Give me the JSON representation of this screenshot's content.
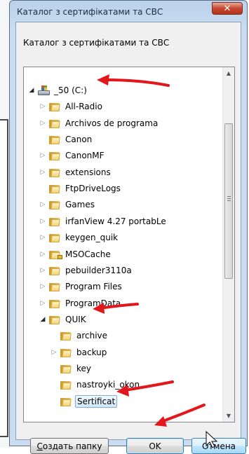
{
  "window": {
    "title": "Каталог з сертифікатами та СВС",
    "close_glyph": "✕"
  },
  "prompt": "Каталог з сертифікатами та СВС",
  "tree": {
    "items": [
      {
        "label": "_50 (C:)",
        "icon": "drive-icon",
        "expand": "open",
        "level": 0
      },
      {
        "label": "All-Radio",
        "icon": "folder-icon",
        "expand": "closed",
        "level": 1
      },
      {
        "label": "Archivos de programa",
        "icon": "folder-icon",
        "expand": "closed",
        "level": 1
      },
      {
        "label": "Canon",
        "icon": "folder-icon",
        "expand": "none",
        "level": 1
      },
      {
        "label": "CanonMF",
        "icon": "folder-icon",
        "expand": "closed",
        "level": 1
      },
      {
        "label": "extensions",
        "icon": "folder-icon",
        "expand": "closed",
        "level": 1
      },
      {
        "label": "FtpDriveLogs",
        "icon": "folder-icon",
        "expand": "none",
        "level": 1
      },
      {
        "label": "Games",
        "icon": "folder-icon",
        "expand": "closed",
        "level": 1
      },
      {
        "label": "irfanView 4.27 portabLe",
        "icon": "folder-icon",
        "expand": "closed",
        "level": 1
      },
      {
        "label": "keygen_quik",
        "icon": "folder-icon",
        "expand": "closed",
        "level": 1
      },
      {
        "label": "MSOCache",
        "icon": "locked-folder-icon",
        "expand": "closed",
        "level": 1
      },
      {
        "label": "pebuilder3110a",
        "icon": "folder-icon",
        "expand": "closed",
        "level": 1
      },
      {
        "label": "Program Files",
        "icon": "folder-icon",
        "expand": "closed",
        "level": 1
      },
      {
        "label": "ProgramData",
        "icon": "folder-icon",
        "expand": "closed",
        "level": 1
      },
      {
        "label": "QUIK",
        "icon": "folder-icon",
        "expand": "open",
        "level": 1
      },
      {
        "label": "archive",
        "icon": "folder-icon",
        "expand": "none",
        "level": 2
      },
      {
        "label": "backup",
        "icon": "folder-icon",
        "expand": "closed",
        "level": 2
      },
      {
        "label": "key",
        "icon": "folder-icon",
        "expand": "none",
        "level": 2
      },
      {
        "label": "nastroyki_okon",
        "icon": "folder-icon",
        "expand": "none",
        "level": 2
      },
      {
        "label": "Sertificat",
        "icon": "folder-icon",
        "expand": "none",
        "level": 2,
        "selected": true
      }
    ]
  },
  "buttons": {
    "new_folder_underlined": "С",
    "new_folder_rest": "оздать папку",
    "ok": "OK",
    "cancel": "Отмена"
  },
  "colors": {
    "annotation_arrow": "#e3161b",
    "selection_border": "#84acdd",
    "close_button": "#c74530"
  }
}
